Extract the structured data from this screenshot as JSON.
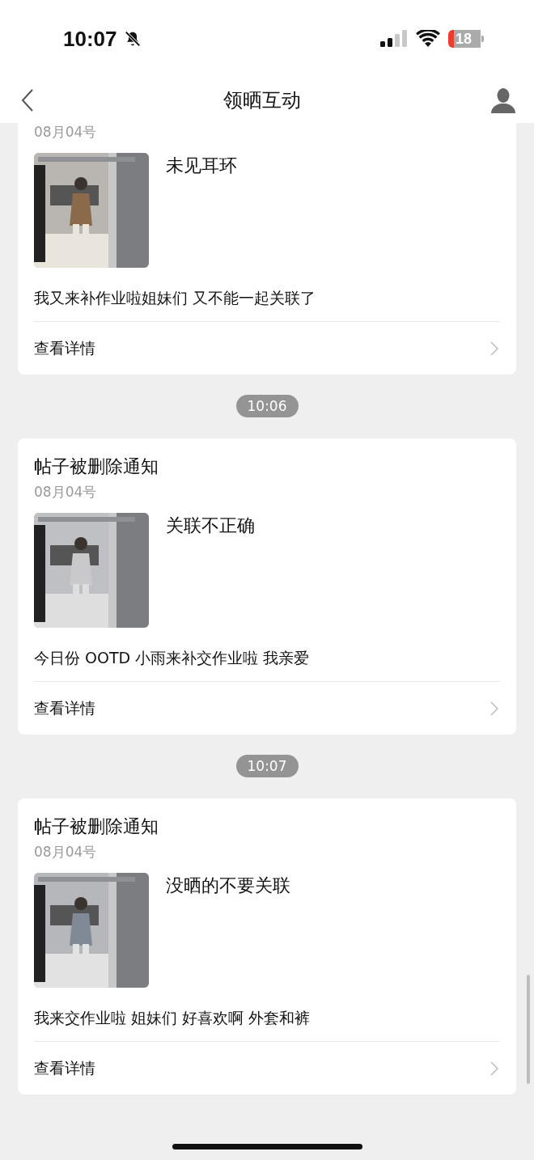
{
  "status_bar": {
    "time": "10:07",
    "battery": "18"
  },
  "nav": {
    "title": "领晒互动"
  },
  "feed": [
    {
      "kind": "card",
      "date": "08月04号",
      "caption": "未见耳环",
      "text": "我又来补作业啦姐妹们 又不能一起关联了",
      "link": "查看详情"
    },
    {
      "kind": "time",
      "time": "10:06"
    },
    {
      "kind": "card",
      "title": "帖子被删除通知",
      "date": "08月04号",
      "caption": "关联不正确",
      "text": "今日份 OOTD 小雨来补交作业啦 我亲爱",
      "link": "查看详情"
    },
    {
      "kind": "time",
      "time": "10:07"
    },
    {
      "kind": "card",
      "title": "帖子被删除通知",
      "date": "08月04号",
      "caption": "没晒的不要关联",
      "text": "我来交作业啦 姐妹们 好喜欢啊 外套和裤",
      "link": "查看详情"
    }
  ]
}
